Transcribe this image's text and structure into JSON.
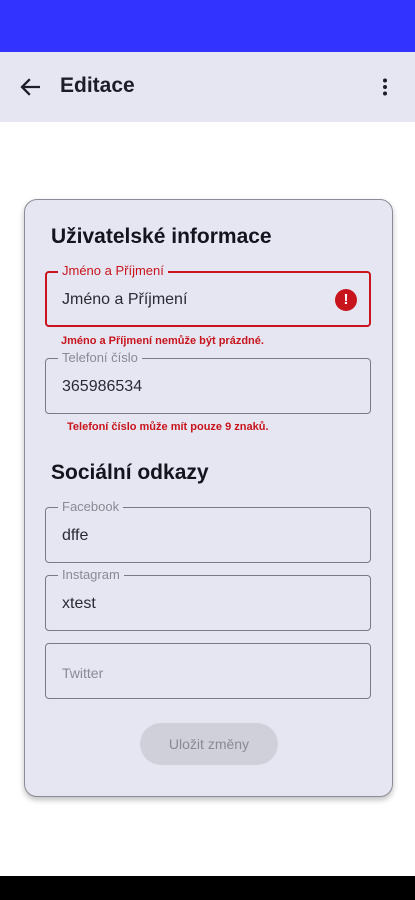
{
  "app_bar": {
    "title": "Editace",
    "back_icon": "arrow-back-icon",
    "menu_icon": "more-vert-icon"
  },
  "user_info": {
    "title": "Uživatelské informace",
    "name_field": {
      "label": "Jméno a Příjmení",
      "value": "Jméno a Příjmení",
      "error": "Jméno a Příjmení nemůže být prázdné.",
      "error_icon": "error-icon"
    },
    "phone_field": {
      "label": "Telefoní číslo",
      "value": "365986534",
      "error": "Telefoní číslo může mít pouze 9 znaků."
    }
  },
  "social": {
    "title": "Sociální odkazy",
    "facebook": {
      "label": "Facebook",
      "value": "dffe"
    },
    "instagram": {
      "label": "Instagram",
      "value": "xtest"
    },
    "twitter": {
      "placeholder": "Twitter"
    }
  },
  "save_button": "Uložit změny",
  "colors": {
    "status_bar": "#3333ff",
    "app_bar": "#e6e6f2",
    "error": "#c8141c",
    "card": "#e6e6f2"
  }
}
